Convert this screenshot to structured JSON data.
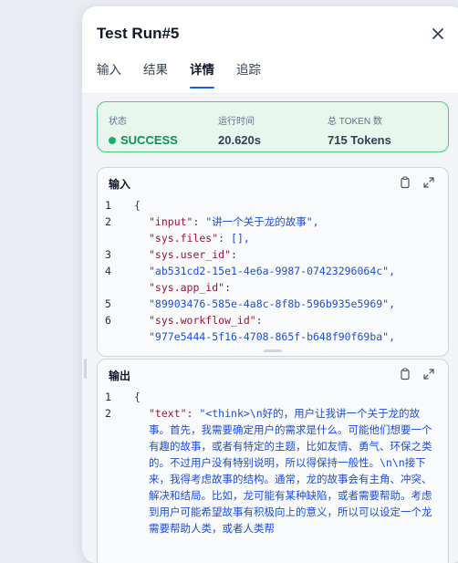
{
  "header": {
    "title": "Test Run#5"
  },
  "tabs": [
    {
      "label": "输入"
    },
    {
      "label": "结果"
    },
    {
      "label": "详情"
    },
    {
      "label": "追踪"
    }
  ],
  "status": {
    "state_label": "状态",
    "state_value": "SUCCESS",
    "time_label": "运行时间",
    "time_value": "20.620s",
    "token_label": "总 TOKEN 数",
    "token_value": "715 Tokens"
  },
  "input_panel": {
    "title": "输入",
    "lines": [
      {
        "n": "1",
        "t": "{"
      },
      {
        "n": "2",
        "k": "\"input\"",
        "v": "\"讲一个关于龙的故事\","
      },
      {
        "n": "",
        "k": "\"sys.files\"",
        "v": "[],"
      },
      {
        "n": "3",
        "k": "\"sys.user_id\"",
        "v": ""
      },
      {
        "n": "4",
        "v2": "\"ab531cd2-15e1-4e6a-9987-07423296064c\","
      },
      {
        "n": "",
        "k": "\"sys.app_id\"",
        "v": ""
      },
      {
        "n": "5",
        "v2": "\"89903476-585e-4a8c-8f8b-596b935e5969\","
      },
      {
        "n": "6",
        "k": "\"sys.workflow_id\"",
        "v": ""
      },
      {
        "n": "",
        "v2": "\"977e5444-5f16-4708-865f-b648f90f69ba\","
      }
    ]
  },
  "output_panel": {
    "title": "输出",
    "line1": "{",
    "key": "\"text\"",
    "value": "\"<think>\\n好的，用户让我讲一个关于龙的故事。首先，我需要确定用户的需求是什么。可能他们想要一个有趣的故事，或者有特定的主题，比如友情、勇气、环保之类的。不过用户没有特别说明，所以得保持一般性。\\n\\n接下来，我得考虑故事的结构。通常，龙的故事会有主角、冲突、解决和结局。比如，龙可能有某种缺陷，或者需要帮助。考虑到用户可能希望故事有积极向上的意义，所以可以设定一个龙需要帮助人类，或者人类帮"
  },
  "colors": {
    "accent": "#155eef",
    "success": "#17b26a",
    "success_bg": "#e7f7ee"
  },
  "icons": [
    "close-icon",
    "copy-icon",
    "expand-icon"
  ]
}
